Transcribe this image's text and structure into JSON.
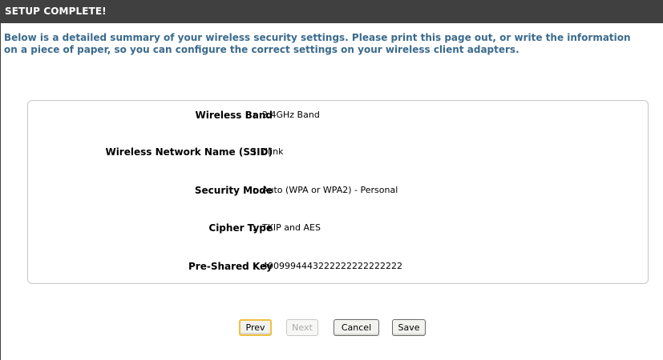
{
  "header": {
    "title": "SETUP COMPLETE!"
  },
  "intro": {
    "text": "Below is a detailed summary of your wireless security settings. Please print this page out, or write the information on a piece of paper, so you can configure the correct settings on your wireless client adapters."
  },
  "summary": {
    "separator": ":",
    "rows": [
      {
        "label": "Wireless Band",
        "value": "2.4GHz Band"
      },
      {
        "label": "Wireless Network Name (SSID)",
        "value": "dlink"
      },
      {
        "label": "Security Mode",
        "value": "Auto (WPA or WPA2) - Personal"
      },
      {
        "label": "Cipher Type",
        "value": "TKIP and AES"
      },
      {
        "label": "Pre-Shared Key",
        "value": "4909994443222222222222222"
      }
    ]
  },
  "buttons": {
    "prev": "Prev",
    "next": "Next",
    "cancel": "Cancel",
    "save": "Save"
  },
  "colors": {
    "header_bg": "#404040",
    "intro_text": "#3a6a8c",
    "focus_ring": "#f0c040"
  }
}
